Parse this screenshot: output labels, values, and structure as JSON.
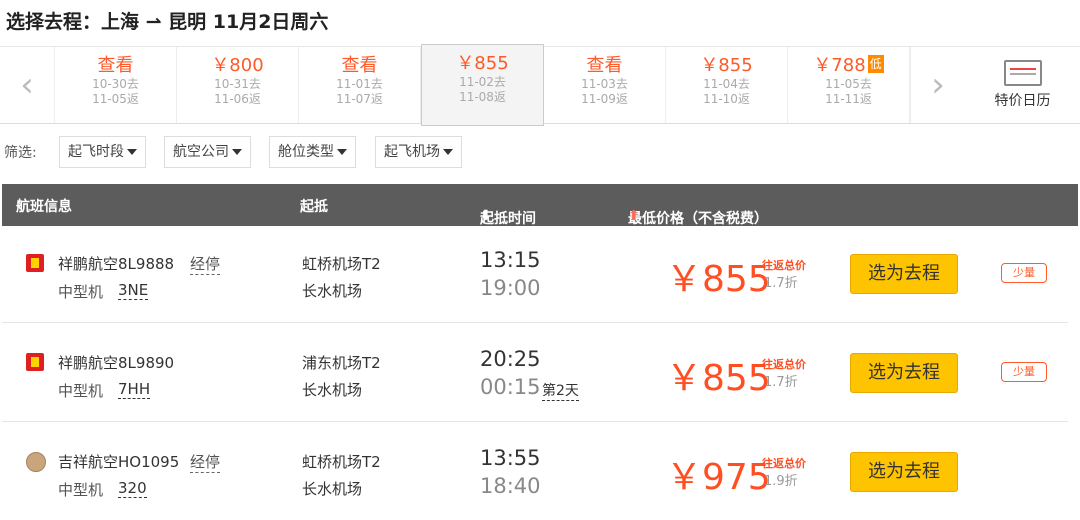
{
  "header": {
    "title": "选择去程：上海 ⇀ 昆明  11月2日周六"
  },
  "date_strip": {
    "prev_icon": "chevron-left-icon",
    "next_icon": "chevron-right-icon",
    "cells": [
      {
        "price": "查看",
        "depart": "10-30去",
        "return": "11-05返"
      },
      {
        "price": "￥800",
        "depart": "10-31去",
        "return": "11-06返"
      },
      {
        "price": "查看",
        "depart": "11-01去",
        "return": "11-07返"
      },
      {
        "price": "￥855",
        "depart": "11-02去",
        "return": "11-08返",
        "selected": true
      },
      {
        "price": "查看",
        "depart": "11-03去",
        "return": "11-09返"
      },
      {
        "price": "￥855",
        "depart": "11-04去",
        "return": "11-10返"
      },
      {
        "price": "￥788",
        "depart": "11-05去",
        "return": "11-11返",
        "badge": "低"
      }
    ],
    "calendar_label": "特价日历"
  },
  "filters": {
    "label": "筛选:",
    "buttons": [
      "起飞时段",
      "航空公司",
      "舱位类型",
      "起飞机场"
    ]
  },
  "table": {
    "headers": {
      "flight": "航班信息",
      "route": "起抵",
      "time": "起抵时间",
      "price": "最低价格（不含税费）"
    },
    "rows": [
      {
        "airline": "祥鹏航空8L9888",
        "stop": "经停",
        "plane_type": "中型机",
        "plane_code": "3NE",
        "dep_airport": "虹桥机场T2",
        "arr_airport": "长水机场",
        "dep_time": "13:15",
        "arr_time": "19:00",
        "next_day": "",
        "price": "￥855",
        "price_note": "往返总价",
        "discount": "1.7折",
        "button": "选为去程",
        "badge": "少量",
        "logo": "luckyair-logo-icon"
      },
      {
        "airline": "祥鹏航空8L9890",
        "stop": "",
        "plane_type": "中型机",
        "plane_code": "7HH",
        "dep_airport": "浦东机场T2",
        "arr_airport": "长水机场",
        "dep_time": "20:25",
        "arr_time": "00:15",
        "next_day": "第2天",
        "price": "￥855",
        "price_note": "往返总价",
        "discount": "1.7折",
        "button": "选为去程",
        "badge": "少量",
        "logo": "luckyair-logo-icon"
      },
      {
        "airline": "吉祥航空HO1095",
        "stop": "经停",
        "plane_type": "中型机",
        "plane_code": "320",
        "dep_airport": "虹桥机场T2",
        "arr_airport": "长水机场",
        "dep_time": "13:55",
        "arr_time": "18:40",
        "next_day": "",
        "price": "￥975",
        "price_note": "往返总价",
        "discount": "1.9折",
        "button": "选为去程",
        "badge": "",
        "logo": "juneyao-logo-icon"
      }
    ]
  },
  "colors": {
    "accent": "#ff5a2a",
    "button": "#ffc400",
    "header_bg": "#5c5c5c"
  }
}
